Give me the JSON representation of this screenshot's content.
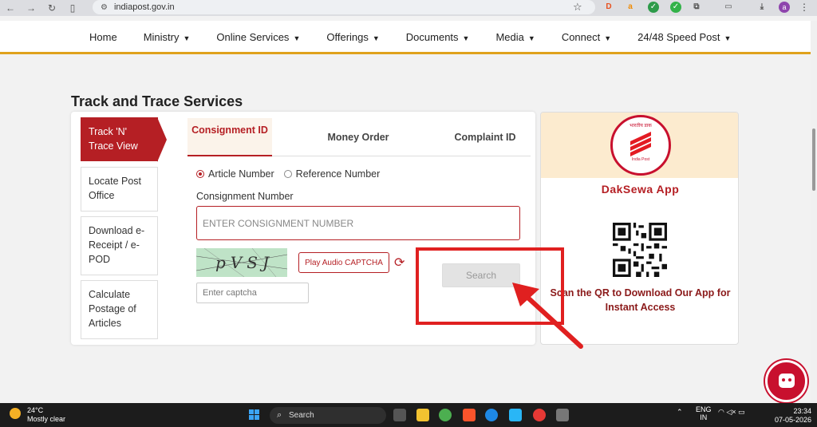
{
  "browser": {
    "url": "indiapost.gov.in",
    "profile_initial": "a"
  },
  "nav": {
    "items": [
      "Home",
      "Ministry",
      "Online Services",
      "Offerings",
      "Documents",
      "Media",
      "Connect",
      "24/48 Speed Post"
    ]
  },
  "page": {
    "title": "Track and Trace Services"
  },
  "side_tabs": [
    {
      "label": "Track 'N' Trace View",
      "active": true
    },
    {
      "label": "Locate Post Office",
      "active": false
    },
    {
      "label": "Download e-Receipt / e-POD",
      "active": false
    },
    {
      "label": "Calculate Postage of Articles",
      "active": false
    }
  ],
  "top_tabs": {
    "consignment": "Consignment ID",
    "money_order": "Money Order",
    "complaint": "Complaint ID"
  },
  "form": {
    "radio_article": "Article Number",
    "radio_reference": "Reference Number",
    "field_label": "Consignment Number",
    "consignment_placeholder": "ENTER CONSIGNMENT NUMBER",
    "captcha_text": "pVSJ",
    "play_audio": "Play Audio CAPTCHA",
    "captcha_placeholder": "Enter captcha",
    "search": "Search"
  },
  "app_card": {
    "logo_text": "भारतीय डाक",
    "logo_sub": "India Post",
    "title": "DakSewa App",
    "qr_text": "Scan the QR to Download Our App for Instant Access"
  },
  "colors": {
    "brand_red": "#b51f24",
    "accent_gold": "#e0a21c",
    "annotation_red": "#e02020"
  },
  "taskbar": {
    "weather_temp": "24°C",
    "weather_desc": "Mostly clear",
    "search": "Search",
    "lang": "ENG",
    "region": "IN",
    "time": "23:34",
    "date": "07-05-2026"
  }
}
